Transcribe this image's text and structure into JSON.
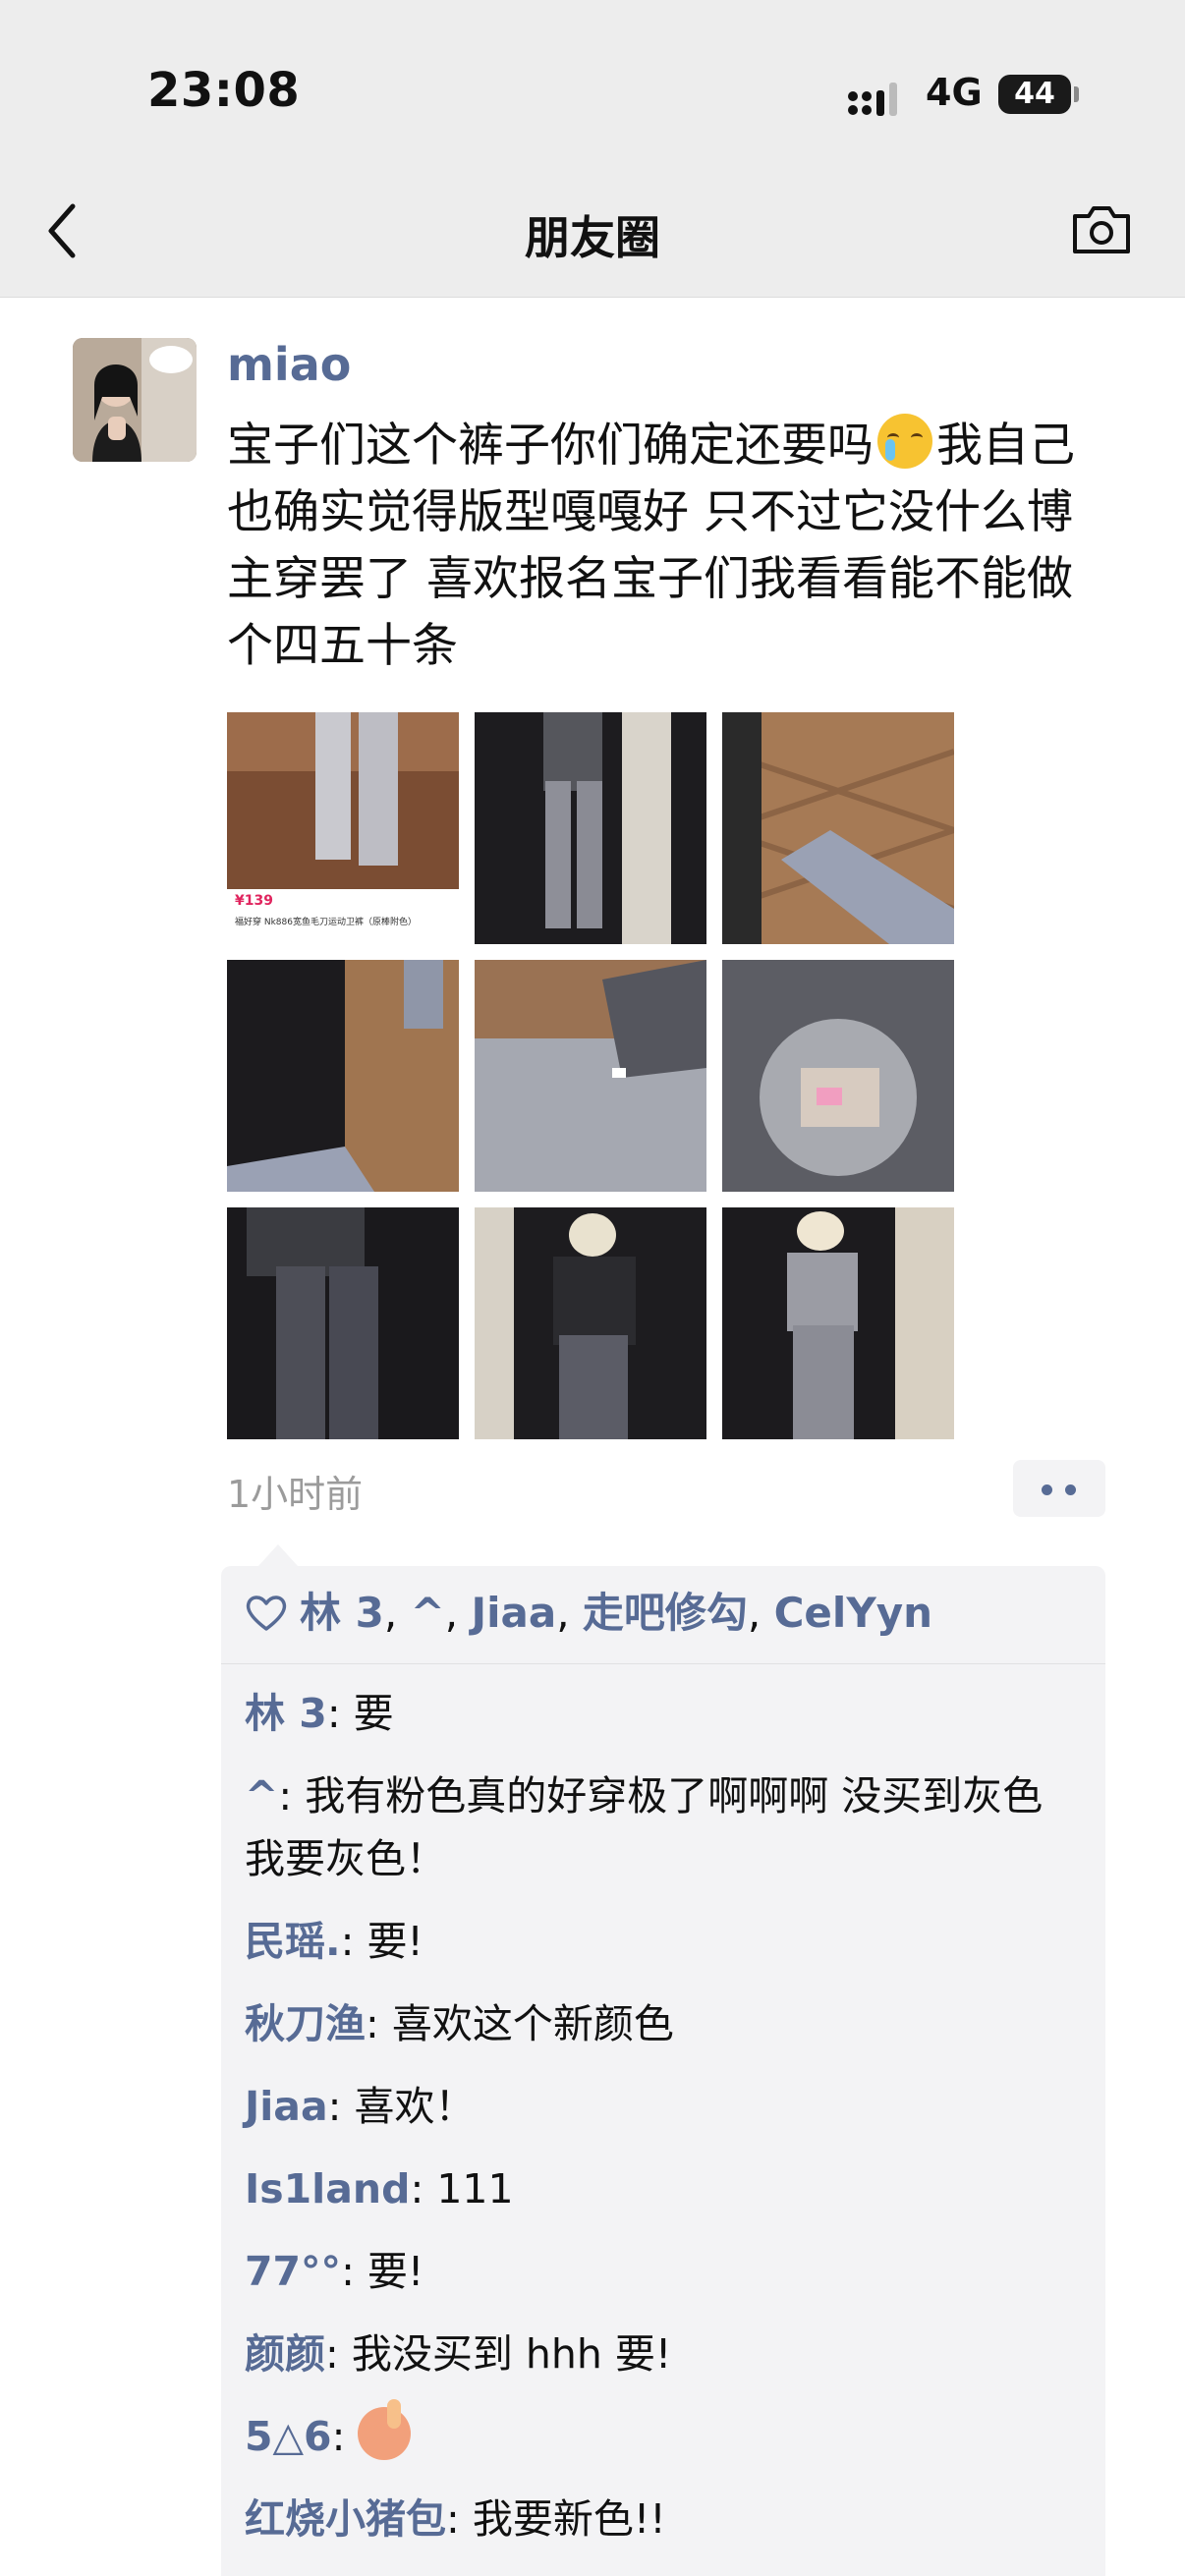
{
  "status_bar": {
    "time": "23:08",
    "network": "4G",
    "battery": "44"
  },
  "nav": {
    "title": "朋友圈"
  },
  "post": {
    "author": "miao",
    "text_before_emoji": "宝子们这个裤子你们确定还要吗",
    "emoji": "crying-face",
    "text_after_emoji": "我自己也确实觉得版型嘎嘎好 只不过它没什么博主穿罢了 喜欢报名宝子们我看看能不能做个四五十条",
    "photo_1_caption": {
      "price": "¥139",
      "desc": "福好穿 Nk886宽鱼毛刀运动卫裤（原棒附色）"
    },
    "time_ago": "1小时前"
  },
  "likes": [
    "林 3",
    "^",
    "Jiaa",
    "走吧修勾",
    "CelYyn"
  ],
  "comments": [
    {
      "user": "林 3",
      "text": "要"
    },
    {
      "user": "^",
      "text": "我有粉色真的好穿极了啊啊啊 没买到灰色 我要灰色！"
    },
    {
      "user": "民瑶.",
      "text": "要!"
    },
    {
      "user": "秋刀渔",
      "text": "喜欢这个新颜色"
    },
    {
      "user": "Jiaa",
      "text": "喜欢！"
    },
    {
      "user": "Is1land",
      "text": "111"
    },
    {
      "user": "77°°",
      "text": "要!"
    },
    {
      "user": "颜颜",
      "text": "我没买到 hhh 要!"
    },
    {
      "user": "5△6",
      "text": "",
      "emoji": "person-raising-hand"
    },
    {
      "user": "红烧小猪包",
      "text": "我要新色!!"
    }
  ],
  "colors": {
    "link_blue": "#576b95",
    "header_bg": "#ededed",
    "comment_bg": "#f3f3f5",
    "muted": "#9b9b9b"
  }
}
